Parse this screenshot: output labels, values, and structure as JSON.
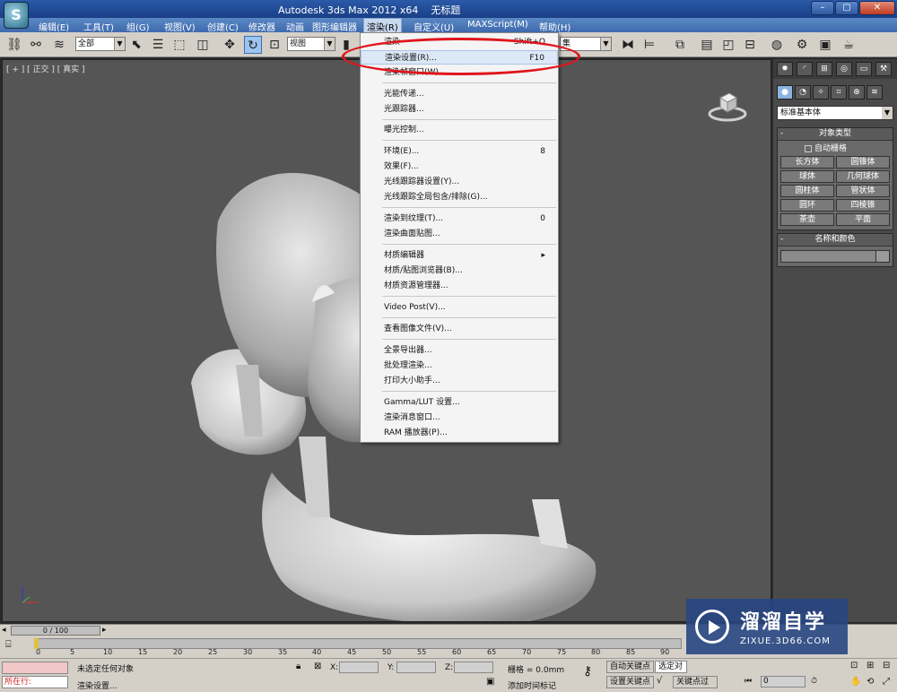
{
  "title": {
    "app": "Autodesk 3ds Max  2012 x64",
    "doc": "无标题"
  },
  "menubar": {
    "items": [
      "编辑(E)",
      "工具(T)",
      "组(G)",
      "视图(V)",
      "创建(C)",
      "修改器",
      "动画",
      "图形编辑器",
      "渲染(R)",
      "自定义(U)",
      "MAXScript(M)",
      "帮助(H)"
    ]
  },
  "toolbar": {
    "selection_filter": "全部",
    "ref_coord": "视图",
    "named_set": "集"
  },
  "viewport": {
    "label": "[ + ] [ 正交 ] [ 真实 ]"
  },
  "render_menu": {
    "items": [
      {
        "label": "渲染",
        "shortcut": "Shift+Q"
      },
      {
        "label": "渲染设置(R)...",
        "shortcut": "F10"
      },
      {
        "label": "渲染帧窗口(W)",
        "shortcut": ""
      },
      {
        "label": "光能传递...",
        "shortcut": ""
      },
      {
        "label": "光跟踪器...",
        "shortcut": ""
      },
      {
        "label": "曝光控制...",
        "shortcut": ""
      },
      {
        "label": "环境(E)...",
        "shortcut": "8"
      },
      {
        "label": "效果(F)...",
        "shortcut": ""
      },
      {
        "label": "光线跟踪器设置(Y)...",
        "shortcut": ""
      },
      {
        "label": "光线跟踪全局包含/排除(G)...",
        "shortcut": ""
      },
      {
        "label": "渲染到纹理(T)...",
        "shortcut": "0"
      },
      {
        "label": "渲染曲面贴图...",
        "shortcut": ""
      },
      {
        "label": "材质编辑器",
        "shortcut": "▸"
      },
      {
        "label": "材质/贴图浏览器(B)...",
        "shortcut": ""
      },
      {
        "label": "材质资源管理器...",
        "shortcut": ""
      },
      {
        "label": "Video Post(V)...",
        "shortcut": ""
      },
      {
        "label": "查看图像文件(V)...",
        "shortcut": ""
      },
      {
        "label": "全景导出器...",
        "shortcut": ""
      },
      {
        "label": "批处理渲染...",
        "shortcut": ""
      },
      {
        "label": "打印大小助手...",
        "shortcut": ""
      },
      {
        "label": "Gamma/LUT 设置...",
        "shortcut": ""
      },
      {
        "label": "渲染消息窗口...",
        "shortcut": ""
      },
      {
        "label": "RAM 播放器(P)...",
        "shortcut": ""
      }
    ]
  },
  "command_panel": {
    "primitive_type": "标准基本体",
    "object_type_title": "对象类型",
    "autogrid": "自动栅格",
    "objects": [
      "长方体",
      "圆锥体",
      "球体",
      "几何球体",
      "圆柱体",
      "管状体",
      "圆环",
      "四棱锥",
      "茶壶",
      "平面"
    ],
    "name_color_title": "名称和颜色"
  },
  "timeline": {
    "frame": "0 / 100",
    "ticks": [
      "0",
      "5",
      "10",
      "15",
      "20",
      "25",
      "30",
      "35",
      "40",
      "45",
      "50",
      "55",
      "60",
      "65",
      "70",
      "75",
      "80",
      "85",
      "90"
    ]
  },
  "status": {
    "listener": "所在行:",
    "selection": "未选定任何对象",
    "prompt": "渲染设置...",
    "x": "X:",
    "y": "Y:",
    "z": "Z:",
    "grid": "栅格 = 0.0mm",
    "auto_key": "自动关键点",
    "selected": "选定对象",
    "set_key": "设置关键点",
    "key_filters": "关键点过滤器...",
    "add_time_tag": "添加时间标记",
    "frame_value": "0"
  },
  "watermark": {
    "brand": "溜溜自学",
    "url": "ZIXUE.3D66.COM"
  }
}
